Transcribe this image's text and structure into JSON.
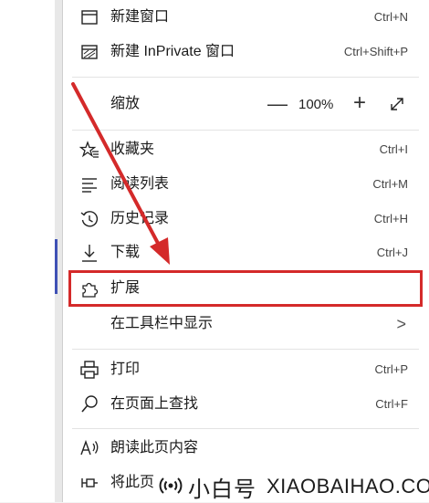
{
  "menu": {
    "new_window": {
      "label": "新建窗口",
      "shortcut": "Ctrl+N",
      "icon": "new-window-icon"
    },
    "new_inprivate": {
      "label": "新建 InPrivate 窗口",
      "shortcut": "Ctrl+Shift+P",
      "icon": "inprivate-icon"
    },
    "zoom": {
      "label": "缩放",
      "minus": "—",
      "value": "100%",
      "plus": "+",
      "icon": "fullscreen-icon"
    },
    "favorites": {
      "label": "收藏夹",
      "shortcut": "Ctrl+I",
      "icon": "favorites-star-icon"
    },
    "reading_list": {
      "label": "阅读列表",
      "shortcut": "Ctrl+M",
      "icon": "reading-list-icon"
    },
    "history": {
      "label": "历史记录",
      "shortcut": "Ctrl+H",
      "icon": "history-icon"
    },
    "downloads": {
      "label": "下载",
      "shortcut": "Ctrl+J",
      "icon": "download-icon"
    },
    "extensions": {
      "label": "扩展",
      "icon": "puzzle-icon"
    },
    "show_in_toolbar": {
      "label": "在工具栏中显示",
      "chevron": ">"
    },
    "print": {
      "label": "打印",
      "shortcut": "Ctrl+P",
      "icon": "printer-icon"
    },
    "find": {
      "label": "在页面上查找",
      "shortcut": "Ctrl+F",
      "icon": "search-icon"
    },
    "read_aloud": {
      "label": "朗读此页内容",
      "icon": "read-aloud-icon"
    },
    "pin": {
      "label": "将此页",
      "icon": "pin-icon"
    }
  },
  "annotation": {
    "highlight_color": "#d42a2a"
  },
  "watermark": {
    "cn": "小白号",
    "en": "XIAOBAIHAO.COM",
    "icon": "broadcast-icon"
  }
}
